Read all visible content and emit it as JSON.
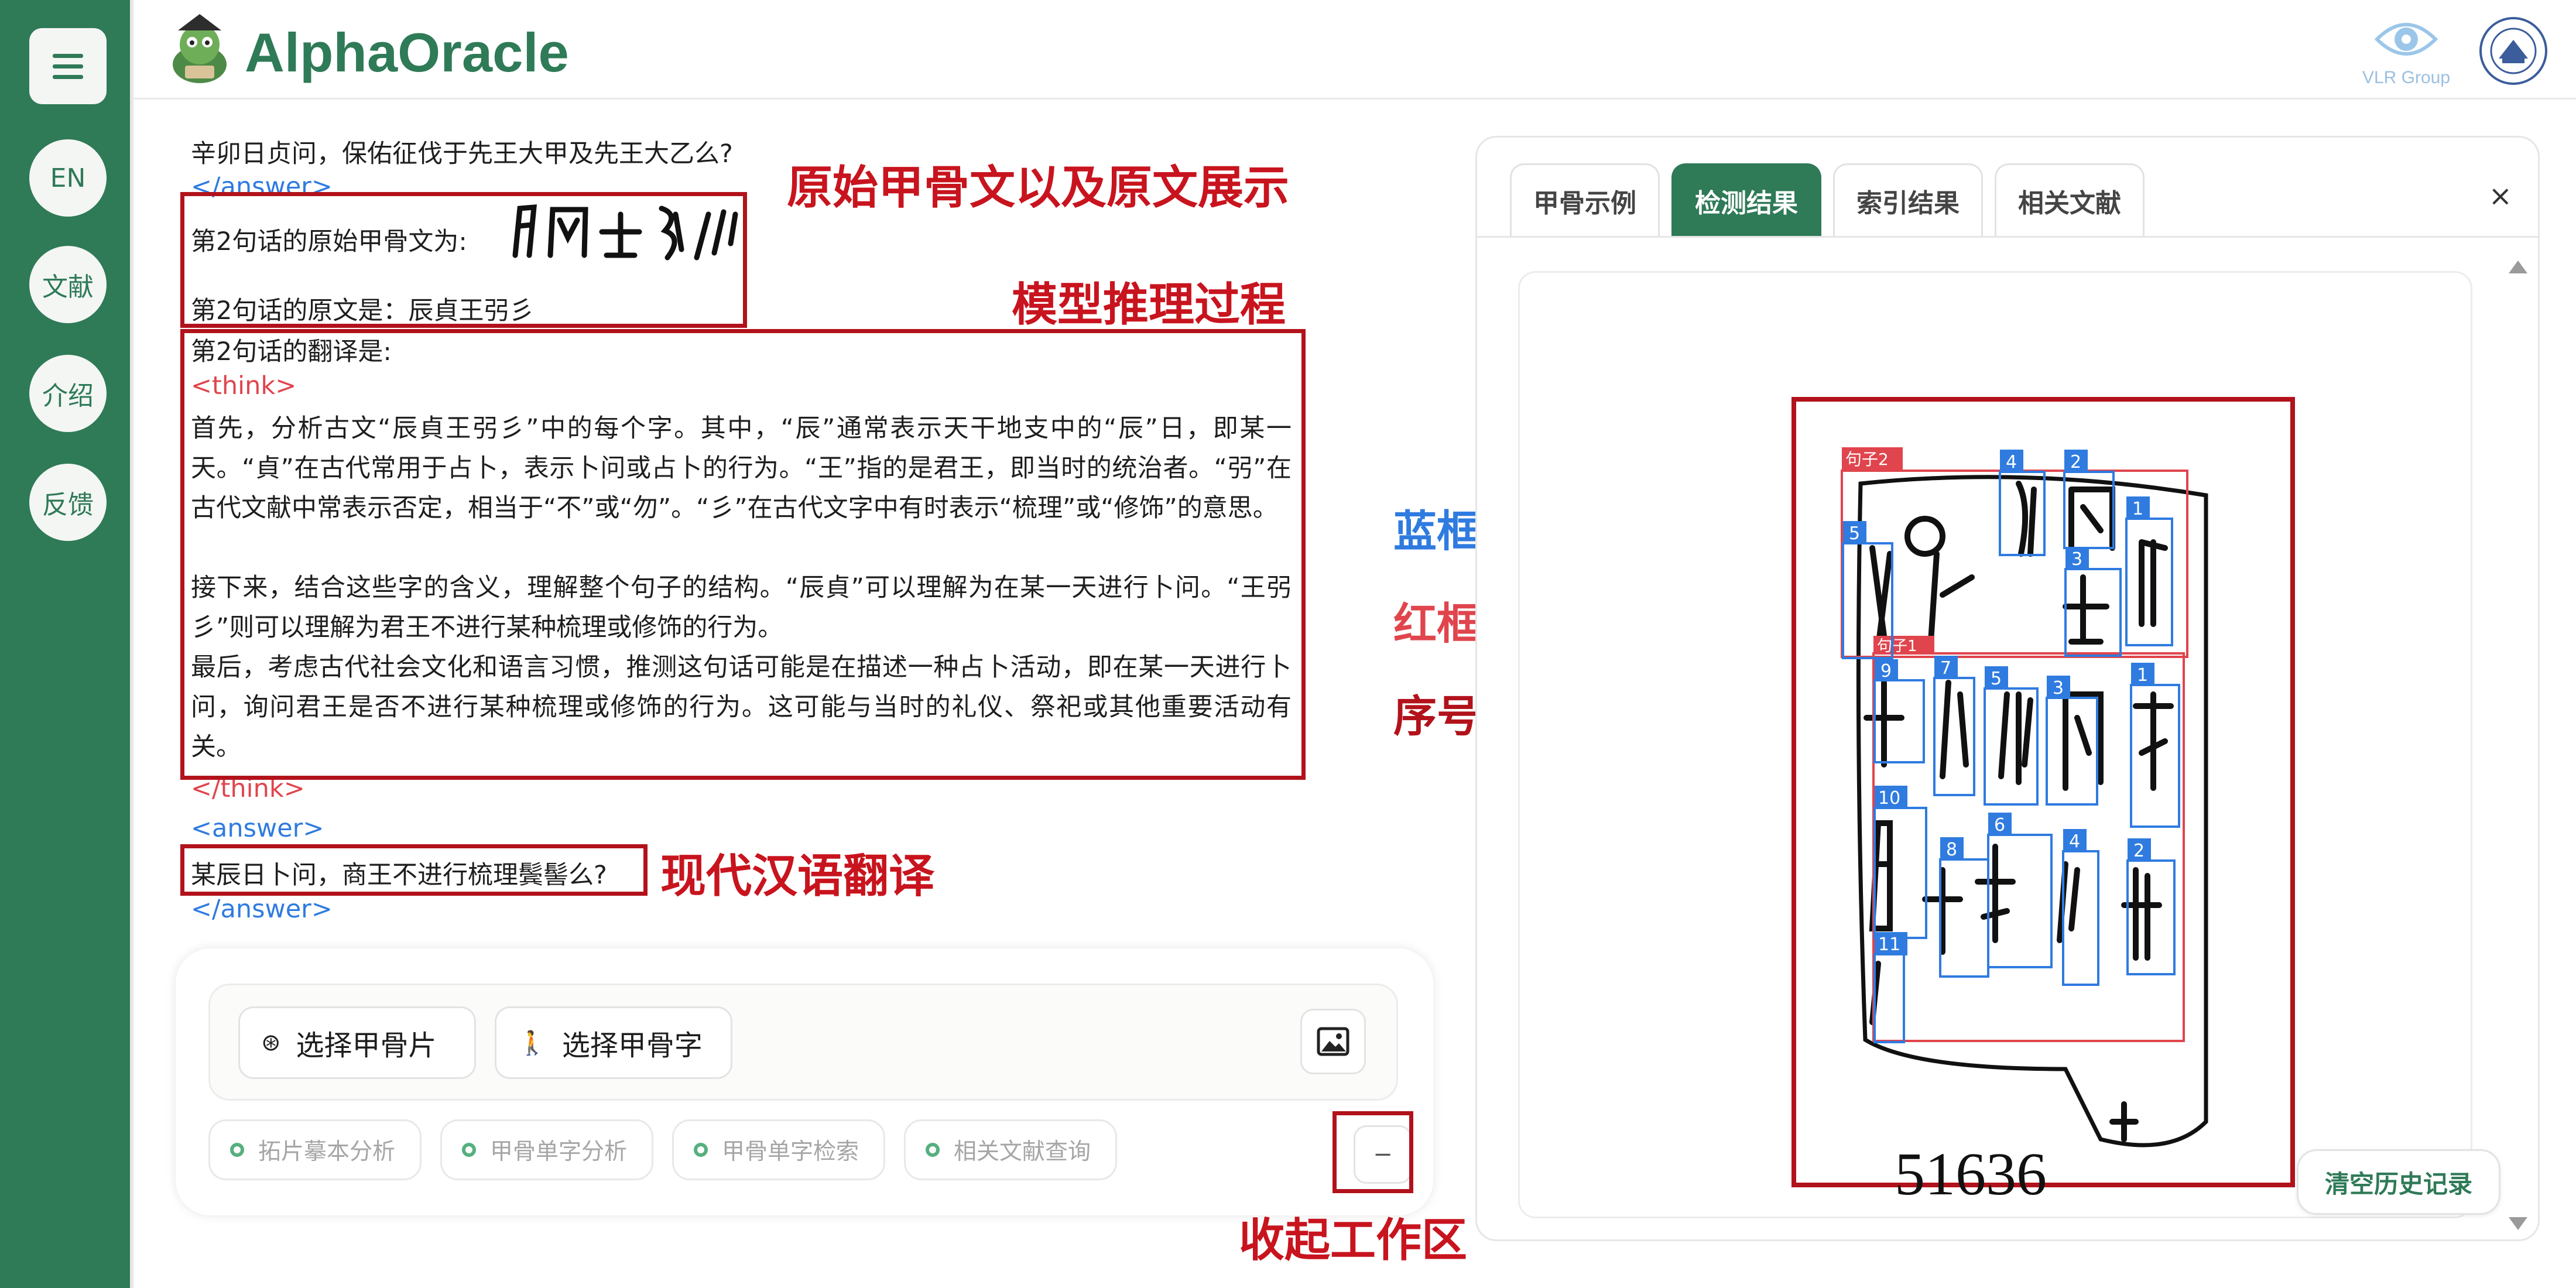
{
  "app": {
    "title": "AlphaOracle"
  },
  "header": {
    "vlr_label": "VLR Group"
  },
  "sidebar": {
    "items": [
      {
        "label": "EN"
      },
      {
        "label": "文献"
      },
      {
        "label": "介绍"
      },
      {
        "label": "反馈"
      }
    ]
  },
  "chat": {
    "line1": "辛卯日贞问，保佑征伐于先王大甲及先王大乙么?",
    "answer_close_1": "</answer>",
    "orig_oracle_label": "第2句话的原始甲骨文为:",
    "orig_text_line": "第2句话的原文是：辰貞王弜彡",
    "translation_label": "第2句话的翻译是:",
    "think_open": "<think>",
    "think_body": "首先，分析古文“辰貞王弜彡”中的每个字。其中，“辰”通常表示天干地支中的“辰”日，即某一天。“貞”在古代常用于占卜，表示卜问或占卜的行为。“王”指的是君王，即当时的统治者。“弜”在古代文献中常表示否定，相当于“不”或“勿”。“彡”在古代文字中有时表示“梳理”或“修饰”的意思。",
    "think_body_2": "接下来，结合这些字的含义，理解整个句子的结构。“辰貞”可以理解为在某一天进行卜问。“王弜彡”则可以理解为君王不进行某种梳理或修饰的行为。",
    "think_body_3": "最后，考虑古代社会文化和语言习惯，推测这句话可能是在描述一种占卜活动，即在某一天进行卜问，询问君王是否不进行某种梳理或修饰的行为。这可能与当时的礼仪、祭祀或其他重要活动有关。",
    "think_close": "</think>",
    "answer_open": "<answer>",
    "modern_translation": "某辰日卜问，商王不进行梳理鬓髻么?",
    "answer_close_2": "</answer>"
  },
  "annotations": {
    "original_display": "原始甲骨文以及原文展示",
    "reasoning": "模型推理过程",
    "modern_translation": "现代汉语翻译",
    "collapse_workspace": "收起工作区",
    "blue_box": "蓝框：单字检测",
    "red_box": "红框：句子检测",
    "order": "序号：阅读顺序"
  },
  "workspace": {
    "select_bone_button": "选择甲骨片",
    "select_char_button": "选择甲骨字",
    "chips": [
      {
        "label": "拓片摹本分析"
      },
      {
        "label": "甲骨单字分析"
      },
      {
        "label": "甲骨单字检索"
      },
      {
        "label": "相关文献查询"
      }
    ],
    "collapse_label": "−"
  },
  "panel": {
    "tabs": [
      {
        "label": "甲骨示例",
        "active": false
      },
      {
        "label": "检测结果",
        "active": true
      },
      {
        "label": "索引结果",
        "active": false
      },
      {
        "label": "相关文献",
        "active": false
      }
    ],
    "close_label": "×",
    "rubbing_number": "51636",
    "sentence_labels": [
      "句子2",
      "句子1"
    ],
    "clear_history_button": "清空历史记录",
    "sentence2_char_numbers": [
      "4",
      "2",
      "5",
      "3",
      "1"
    ],
    "sentence1_char_numbers": [
      "9",
      "7",
      "5",
      "3",
      "1",
      "10",
      "8",
      "6",
      "4",
      "2",
      "11"
    ]
  },
  "colors": {
    "brand": "#2f7a57",
    "annotation_red": "#b2121b",
    "detect_blue": "#2f7be0",
    "sentence_red": "#e0454d"
  }
}
